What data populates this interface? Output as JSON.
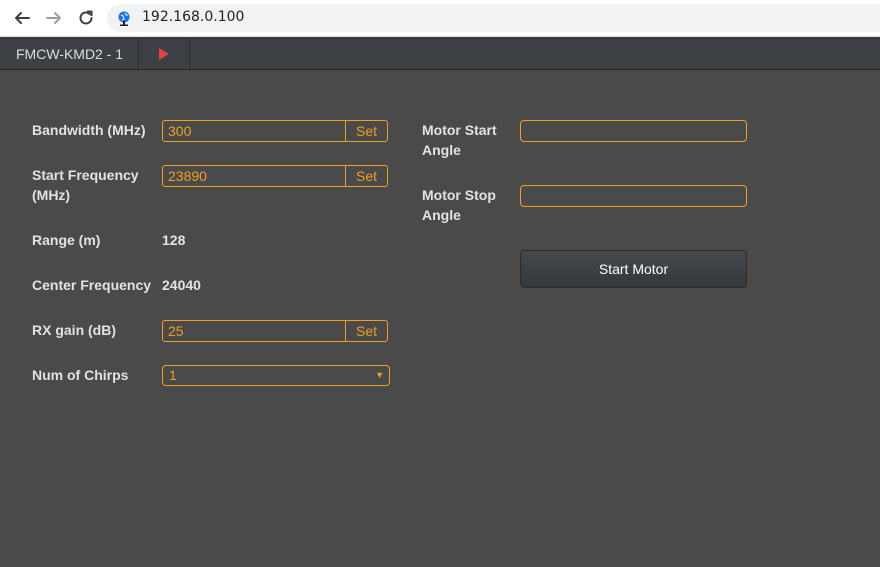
{
  "browser": {
    "url": "192.168.0.100"
  },
  "tab_bar": {
    "tab_title": "FMCW-KMD2 - 1"
  },
  "form": {
    "bandwidth": {
      "label": "Bandwidth (MHz)",
      "value": "300",
      "button": "Set"
    },
    "start_frequency": {
      "label_line1": "Start Frequency",
      "label_line2": "(MHz)",
      "value": "23890",
      "button": "Set"
    },
    "range": {
      "label": "Range (m)",
      "value": "128"
    },
    "center_frequency": {
      "label": "Center Frequency",
      "value": "24040"
    },
    "rx_gain": {
      "label": "RX gain (dB)",
      "value": "25",
      "button": "Set"
    },
    "num_chirps": {
      "label": "Num of Chirps",
      "selected": "1"
    }
  },
  "motor": {
    "start_angle": {
      "label_line1": "Motor Start",
      "label_line2": "Angle",
      "value": ""
    },
    "stop_angle": {
      "label_line1": "Motor Stop",
      "label_line2": "Angle",
      "value": ""
    },
    "start_button": "Start Motor"
  },
  "colors": {
    "accent": "#f0a020",
    "background": "#4a4a4a",
    "play_icon": "#e84040"
  }
}
